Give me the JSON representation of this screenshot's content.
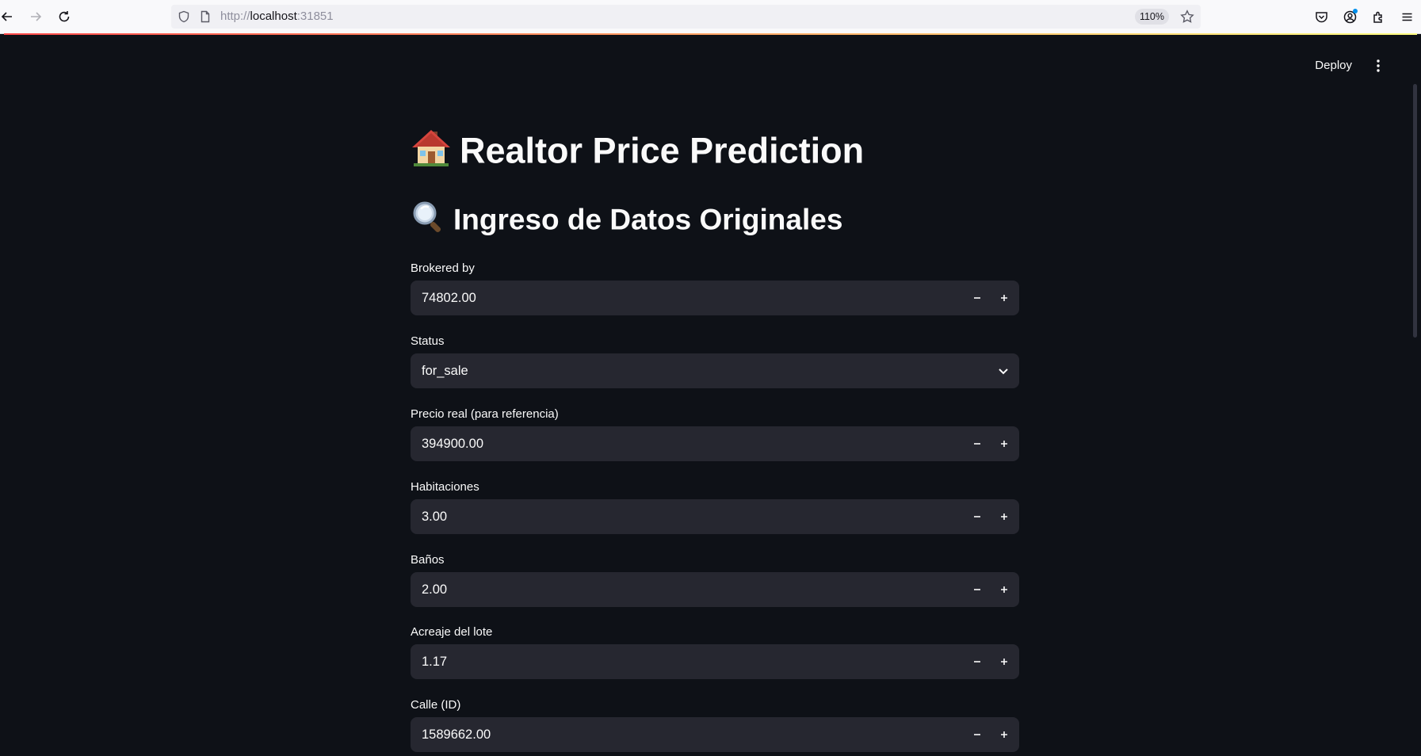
{
  "browser": {
    "url_prefix": "http://",
    "url_host": "localhost",
    "url_port": ":31851",
    "zoom": "110%"
  },
  "header": {
    "deploy_label": "Deploy"
  },
  "main": {
    "title": "Realtor Price Prediction",
    "title_icon": "house-emoji-icon",
    "subtitle": "Ingreso de Datos Originales",
    "subtitle_icon": "magnifying-glass-emoji-icon"
  },
  "fields": [
    {
      "label": "Brokered by",
      "value": "74802.00",
      "type": "number"
    },
    {
      "label": "Status",
      "value": "for_sale",
      "type": "select"
    },
    {
      "label": "Precio real (para referencia)",
      "value": "394900.00",
      "type": "number"
    },
    {
      "label": "Habitaciones",
      "value": "3.00",
      "type": "number"
    },
    {
      "label": "Baños",
      "value": "2.00",
      "type": "number"
    },
    {
      "label": "Acreaje del lote",
      "value": "1.17",
      "type": "number"
    },
    {
      "label": "Calle (ID)",
      "value": "1589662.00",
      "type": "number"
    }
  ],
  "colors": {
    "app_bg": "#0e1117",
    "input_bg": "#262730",
    "text": "#fafafa",
    "accent_start": "#ff4b4b",
    "accent_end": "#fffd80"
  }
}
